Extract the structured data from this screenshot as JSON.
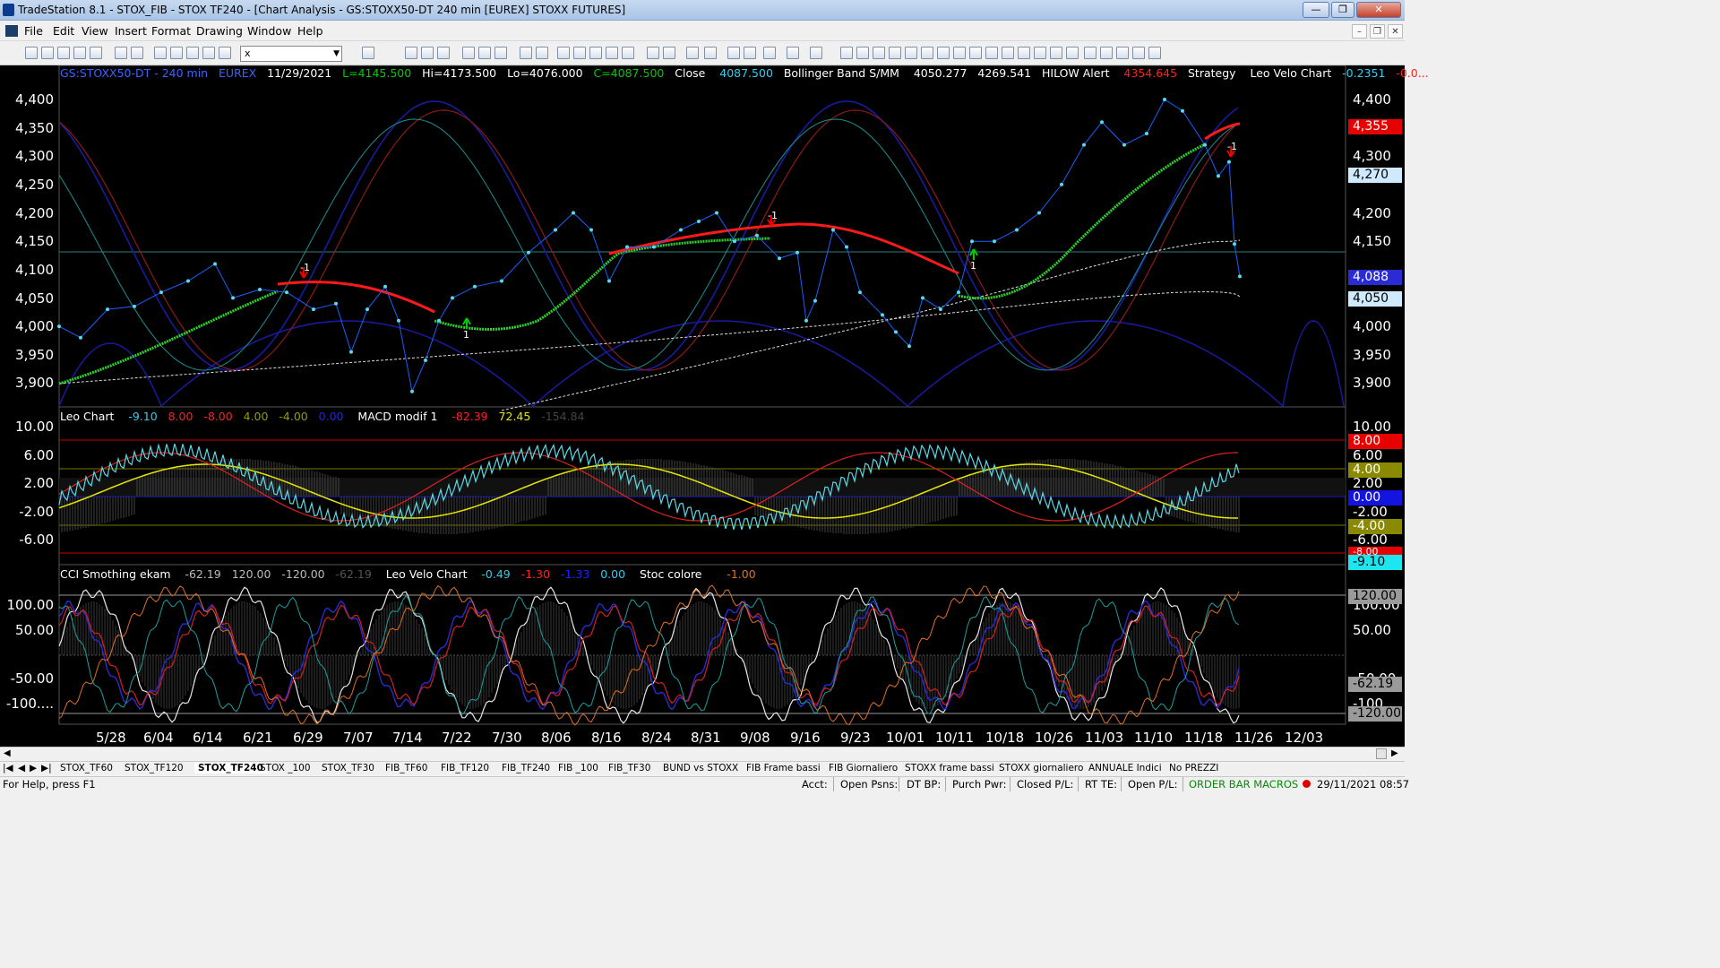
{
  "window": {
    "title": "TradeStation 8.1 - STOX_FIB - STOX TF240 - [Chart Analysis - GS:STOXX50-DT  240 min  [EUREX] STOXX FUTURES]",
    "minimize": "—",
    "restore": "❐",
    "close": "✕"
  },
  "menu": {
    "items": [
      "File",
      "Edit",
      "View",
      "Insert",
      "Format",
      "Drawing",
      "Window",
      "Help"
    ],
    "mdi_minimize": "–",
    "mdi_restore": "❐",
    "mdi_close": "✕"
  },
  "toolbar": {
    "combo_value": "x",
    "combo_arrow": "▼"
  },
  "price_header": {
    "symbol": "GS:STOXX50-DT - 240 min",
    "exchange": "EUREX",
    "date": "11/29/2021",
    "last": "L=4145.500",
    "high": "Hi=4173.500",
    "low": "Lo=4076.000",
    "close_label": "C=4087.500",
    "close_text": "Close",
    "close_value": "4087.500",
    "bb_name": "Bollinger Band S/MM",
    "bb_low": "4050.277",
    "bb_high": "4269.541",
    "hilow_name": "HILOW Alert",
    "hilow_value": "4354.645",
    "strategy": "Strategy",
    "leo_name": "Leo Velo Chart",
    "leo_v1": "-0.2351",
    "leo_v2": "-0.0..."
  },
  "macd_header": {
    "leo_name": "Leo Chart",
    "v1": "-9.10",
    "v2": "8.00",
    "v3": "-8.00",
    "v4": "4.00",
    "v5": "-4.00",
    "v6": "0.00",
    "macd_name": "MACD modif 1",
    "m1": "-82.39",
    "m2": "72.45",
    "m3": "-154.84"
  },
  "cci_header": {
    "cci_name": "CCI Smothing ekam",
    "c1": "-62.19",
    "c2": "120.00",
    "c3": "-120.00",
    "c4": "-62.19",
    "leo_name": "Leo Velo Chart",
    "l1": "-0.49",
    "l2": "-1.30",
    "l3": "-1.33",
    "l4": "0.00",
    "stoc_name": "Stoc colore",
    "s1": "-1.00"
  },
  "price_axis_labels": [
    "4,400",
    "4,350",
    "4,300",
    "4,250",
    "4,200",
    "4,150",
    "4,100",
    "4,050",
    "4,000",
    "3,950",
    "3,900"
  ],
  "macd_axis_labels": [
    "10.00",
    "6.00",
    "2.00",
    "-2.00",
    "-6.00"
  ],
  "cci_axis_labels": [
    "100.00",
    "50.00",
    "-50.00",
    "-100...."
  ],
  "price_badges": {
    "hilow": "4,355",
    "bb_upper": "4,270",
    "last": "4,088",
    "bb_lower": "4,050"
  },
  "macd_badges": {
    "upper": "8.00",
    "mid_upper": "4.00",
    "zero": "0.00",
    "mid_lower": "-4.00",
    "lower": "-8.00",
    "last": "-9.10"
  },
  "cci_badges": {
    "upper": "120.00",
    "last": "-62.19",
    "lower": "-120.00"
  },
  "signal_labels": {
    "sell": "-1",
    "buy": "1"
  },
  "x_axis_labels": [
    "5/28",
    "6/04",
    "6/14",
    "6/21",
    "6/29",
    "7/07",
    "7/14",
    "7/22",
    "7/30",
    "8/06",
    "8/16",
    "8/24",
    "8/31",
    "9/08",
    "9/16",
    "9/23",
    "10/01",
    "10/11",
    "10/18",
    "10/26",
    "11/03",
    "11/10",
    "11/18",
    "11/26",
    "12/03"
  ],
  "sheet_tabs": [
    "STOX_TF60",
    "STOX_TF120",
    "STOX_TF240",
    "STOX _100",
    "STOX_TF30",
    "FIB_TF60",
    "FIB_TF120",
    "FIB_TF240",
    "FIB _100",
    "FIB_TF30",
    "BUND vs STOXX",
    "FIB Frame bassi",
    "FIB Giornaliero",
    "STOXX frame bassi",
    "STOXX giornaliero",
    "ANNUALE Indici",
    "No PREZZI"
  ],
  "tab_nav": [
    "|◀",
    "◀",
    "▶",
    "▶|"
  ],
  "status": {
    "help": "For Help, press F1",
    "acct": "Acct:",
    "open_psns": "Open Psns:",
    "dt_bp": "DT BP:",
    "purch_pwr": "Purch Pwr:",
    "closed_pl": "Closed P/L:",
    "rt_te": "RT TE:",
    "open_pl": "Open P/L:",
    "macros": "ORDER BAR  MACROS",
    "datetime": "29/11/2021 08:57"
  },
  "colors": {
    "price_line": "#5ad9e8",
    "bb_red": "#ff1a1a",
    "bb_dark_red": "#8b1a1a",
    "blue_curve": "#1a1aa0",
    "green_trend": "#2bd42b",
    "yellow": "#e6e600",
    "header_green": "#00cc00",
    "header_cyan": "#33ccee"
  }
}
